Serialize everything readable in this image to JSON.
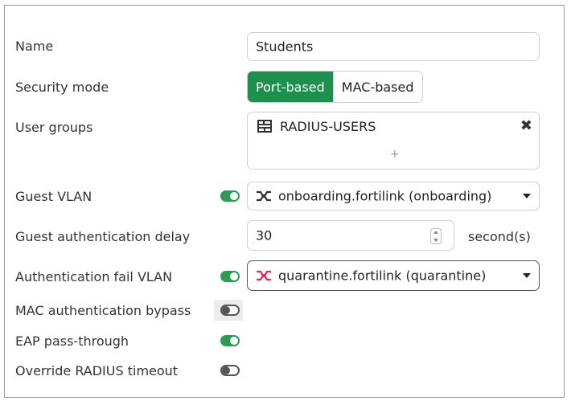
{
  "form": {
    "name_label": "Name",
    "name_value": "Students",
    "security_mode_label": "Security mode",
    "security_mode_options": [
      "Port-based",
      "MAC-based"
    ],
    "security_mode_selected": "Port-based",
    "user_groups_label": "User groups",
    "user_group_item": "RADIUS-USERS",
    "add_symbol": "+",
    "remove_symbol": "✖",
    "guest_vlan_label": "Guest VLAN",
    "guest_vlan_enabled": true,
    "guest_vlan_value": "onboarding.fortilink (onboarding)",
    "guest_auth_delay_label": "Guest authentication delay",
    "guest_auth_delay_value": "30",
    "guest_auth_delay_unit": "second(s)",
    "auth_fail_vlan_label": "Authentication fail VLAN",
    "auth_fail_vlan_enabled": true,
    "auth_fail_vlan_value": "quarantine.fortilink (quarantine)",
    "mac_bypass_label": "MAC authentication bypass",
    "mac_bypass_enabled": false,
    "eap_passthrough_label": "EAP pass-through",
    "eap_passthrough_enabled": true,
    "override_radius_label": "Override RADIUS timeout",
    "override_radius_enabled": false
  },
  "icons": {
    "user_group": "group-icon",
    "guest_vlan": "network-interface-icon",
    "auth_fail_vlan": "network-interface-icon"
  },
  "colors": {
    "accent_green": "#1f8f4e",
    "quarantine_red": "#d9304f"
  }
}
